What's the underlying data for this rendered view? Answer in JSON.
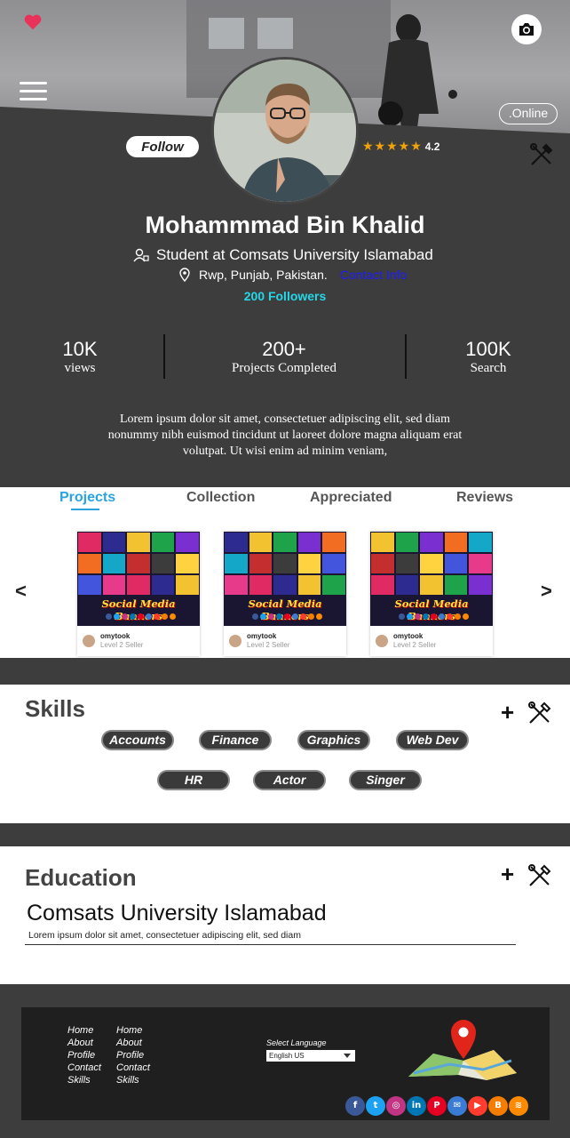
{
  "profile": {
    "name": "Mohammmad Bin Khalid",
    "role": "Student at Comsats University Islamabad",
    "location": "Rwp, Punjab, Pakistan.",
    "contact_label": "Contact Info",
    "followers": "200 Followers",
    "status": ".Online",
    "follow_label": "Follow",
    "rating": "4.2",
    "stars": "★★★★★"
  },
  "stats": [
    {
      "value": "10K",
      "label": "views"
    },
    {
      "value": "200+",
      "label": "Projects Completed"
    },
    {
      "value": "100K",
      "label": "Search"
    }
  ],
  "bio": "Lorem ipsum dolor sit amet, consectetuer adipiscing elit, sed diam nonummy nibh euismod tincidunt ut laoreet dolore magna aliquam erat volutpat. Ut wisi enim ad minim veniam,",
  "tabs": [
    {
      "label": "Projects",
      "active": true
    },
    {
      "label": "Collection",
      "active": false
    },
    {
      "label": "Appreciated",
      "active": false
    },
    {
      "label": "Reviews",
      "active": false
    }
  ],
  "carousel": {
    "prev": "<",
    "next": ">",
    "cards": [
      {
        "title": "Social Media Banners",
        "user": "omytook",
        "level": "Level 2 Seller"
      },
      {
        "title": "Social Media Banners",
        "user": "omytook",
        "level": "Level 2 Seller"
      },
      {
        "title": "Social Media Banners",
        "user": "omytook",
        "level": "Level 2 Seller"
      }
    ]
  },
  "skills": {
    "title": "Skills",
    "add": "+",
    "items": [
      "Accounts",
      "Finance",
      "Graphics",
      "Web Dev",
      "HR",
      "Actor",
      "Singer"
    ]
  },
  "education": {
    "title": "Education",
    "add": "+",
    "school": "Comsats University Islamabad",
    "description": "Lorem ipsum dolor sit amet, consectetuer adipiscing elit, sed diam"
  },
  "footer": {
    "links_col1": [
      "Home",
      "About",
      "Profile",
      "Contact",
      "Skills"
    ],
    "links_col2": [
      "Home",
      "About",
      "Profile",
      "Contact",
      "Skills"
    ],
    "language_label": "Select Language",
    "language_value": "English US",
    "socials": [
      {
        "name": "facebook-icon",
        "glyph": "f",
        "color": "#3b5998"
      },
      {
        "name": "twitter-icon",
        "glyph": "t",
        "color": "#1da1f2"
      },
      {
        "name": "instagram-icon",
        "glyph": "◎",
        "color": "#c13584"
      },
      {
        "name": "linkedin-icon",
        "glyph": "in",
        "color": "#0077b5"
      },
      {
        "name": "pinterest-icon",
        "glyph": "P",
        "color": "#e60023"
      },
      {
        "name": "email-icon",
        "glyph": "✉",
        "color": "#3a7bd5"
      },
      {
        "name": "youtube-icon",
        "glyph": "▶",
        "color": "#ff3d2e"
      },
      {
        "name": "blogger-icon",
        "glyph": "B",
        "color": "#f57d00"
      },
      {
        "name": "rss-icon",
        "glyph": "≋",
        "color": "#ff8a00"
      }
    ]
  },
  "colors": {
    "dark": "#3d3d3d",
    "accent": "#2aa4e0",
    "followers": "#23d8e8",
    "star": "#f0a20a",
    "heart": "#e8325a"
  }
}
